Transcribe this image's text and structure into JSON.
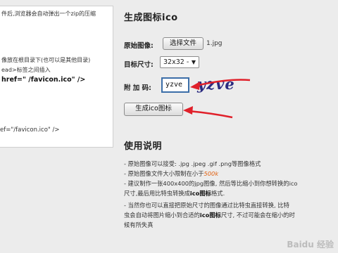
{
  "left_panel": {
    "lines": [
      "件后,浏览器会自动弹出一个zip的压缩",
      "",
      "像放在根目录下(也可以是其他目录)",
      "ead>标签之间插入",
      " href=\" /favicon.ico\" />"
    ],
    "code_line": "ef=\"/favicon.ico\" />"
  },
  "form": {
    "title": "生成图标ico",
    "original_image_label": "原始图像:",
    "choose_file_button": "选择文件",
    "file_name": "1.jpg",
    "target_size_label": "目标尺寸:",
    "target_size_value": "32x32 -",
    "captcha_label": "附 加 码:",
    "captcha_value": "yzve",
    "captcha_image_text": "yzve",
    "generate_button": "生成ico图标"
  },
  "usage": {
    "title": "使用说明",
    "line1": "- 原始图像可以接受: .jpg .jpeg .gif .png等图像格式",
    "line2_prefix": "- 原始图像文件大小限制在小于",
    "line2_highlight": "500k",
    "line3": "- 建议制作一张400x400的jpg图像, 然后等比缩小到你想转换的ico",
    "line4_prefix": "尺寸,最后用比特虫转换成",
    "line4_bold": "ico图标",
    "line4_suffix": "格式.",
    "line5": "- 当然你也可以直接把原始尺寸的图像通过比特虫直接转换, 比特",
    "line6_prefix": "虫会自动将图片缩小到合适的",
    "line6_bold": "ico图标",
    "line6_suffix": "尺寸, 不过可能会在缩小的时",
    "line7": "候有所失真"
  },
  "colors": {
    "arrow": "#e0202a",
    "highlight": "#e06010",
    "captcha_text": "#2a2a80"
  },
  "watermark": "Baidu 经验"
}
